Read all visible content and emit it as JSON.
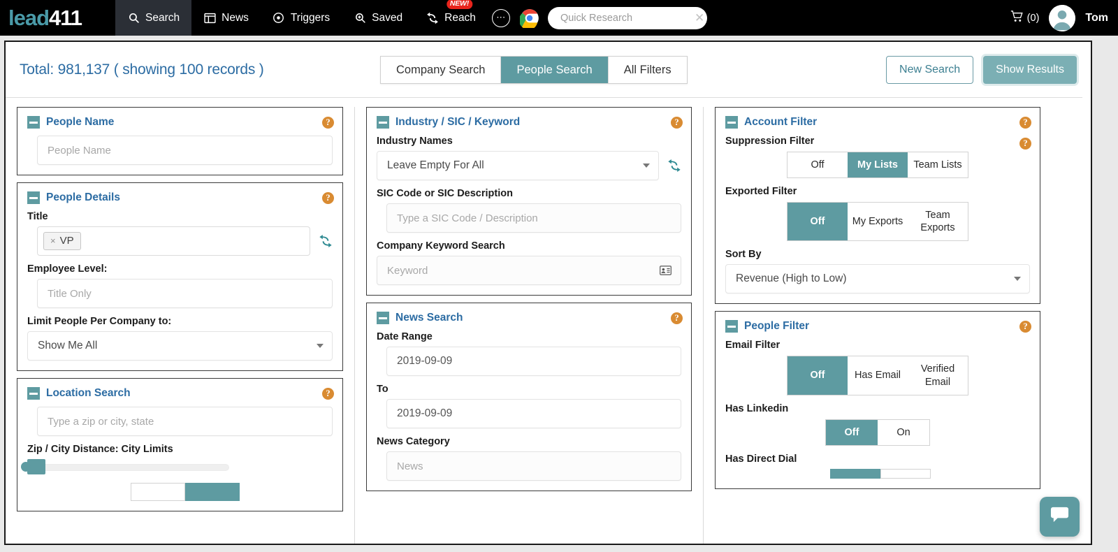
{
  "topnav": {
    "brand_lead": "lead",
    "brand_num": "411",
    "items": [
      {
        "label": "Search",
        "icon": "search-icon",
        "active": true
      },
      {
        "label": "News",
        "icon": "news-icon",
        "active": false
      },
      {
        "label": "Triggers",
        "icon": "target-icon",
        "active": false
      },
      {
        "label": "Saved",
        "icon": "saved-search-icon",
        "active": false
      },
      {
        "label": "Reach",
        "icon": "refresh-icon",
        "active": false,
        "badge": "NEW!"
      }
    ],
    "more_label": "⋯",
    "quick_research": {
      "value": "",
      "placeholder": "Quick Research",
      "clear": "✕"
    },
    "cart_label": "(0)",
    "user_name": "Tom"
  },
  "subheader": {
    "total_text": "Total: 981,137 ( showing 100 records )",
    "tabs": [
      {
        "label": "Company Search",
        "active": false
      },
      {
        "label": "People Search",
        "active": true
      },
      {
        "label": "All Filters",
        "active": false
      }
    ],
    "new_search": "New Search",
    "show_results": "Show Results"
  },
  "left_column": {
    "people_name": {
      "title": "People Name",
      "help": "?",
      "input": {
        "value": "",
        "placeholder": "People Name"
      }
    },
    "people_details": {
      "title": "People Details",
      "help": "?",
      "title_label": "Title",
      "title_tags": [
        {
          "label": "VP",
          "remove": "×"
        }
      ],
      "employee_level_label": "Employee Level:",
      "employee_level_input": {
        "value": "",
        "placeholder": "Title Only"
      },
      "limit_label": "Limit People Per Company to:",
      "limit_value": "Show Me All"
    },
    "location_search": {
      "title": "Location Search",
      "help": "?",
      "location_input": {
        "value": "",
        "placeholder": "Type a zip or city, state"
      },
      "distance_label": "Zip / City Distance: City Limits"
    }
  },
  "middle_column": {
    "industry": {
      "title": "Industry / SIC / Keyword",
      "help": "?",
      "industry_names_label": "Industry Names",
      "industry_names_value": "Leave Empty For All",
      "sic_label": "SIC Code or SIC Description",
      "sic_input": {
        "value": "",
        "placeholder": "Type a SIC Code / Description"
      },
      "keyword_label": "Company Keyword Search",
      "keyword_input": {
        "value": "",
        "placeholder": "Keyword"
      }
    },
    "news_search": {
      "title": "News Search",
      "help": "?",
      "date_range_label": "Date Range",
      "date_from": "2019-09-09",
      "to_label": "To",
      "date_to": "2019-09-09",
      "category_label": "News Category",
      "category_input": {
        "value": "",
        "placeholder": "News"
      }
    }
  },
  "right_column": {
    "account_filter": {
      "title": "Account Filter",
      "help1": "?",
      "help2": "?",
      "suppression_label": "Suppression Filter",
      "suppression_options": [
        {
          "label": "Off",
          "on": false
        },
        {
          "label": "My Lists",
          "on": true
        },
        {
          "label": "Team Lists",
          "on": false
        }
      ],
      "exported_label": "Exported Filter",
      "exported_options": [
        {
          "label": "Off",
          "on": true
        },
        {
          "label": "My Exports",
          "on": false
        },
        {
          "label": "Team Exports",
          "on": false
        }
      ],
      "sort_by_label": "Sort By",
      "sort_by_value": "Revenue (High to Low)"
    },
    "people_filter": {
      "title": "People Filter",
      "help": "?",
      "email_label": "Email Filter",
      "email_options": [
        {
          "label": "Off",
          "on": true
        },
        {
          "label": "Has Email",
          "on": false
        },
        {
          "label": "Verified Email",
          "on": false
        }
      ],
      "linkedin_label": "Has Linkedin",
      "linkedin_options": [
        {
          "label": "Off",
          "on": true
        },
        {
          "label": "On",
          "on": false
        }
      ],
      "direct_dial_label": "Has Direct Dial"
    }
  },
  "colors": {
    "teal": "#5e9ba1",
    "blue_title": "#2c6ca3",
    "orange_help": "#d98b32",
    "nav_bg": "#000000",
    "badge_red": "#e8241c"
  }
}
